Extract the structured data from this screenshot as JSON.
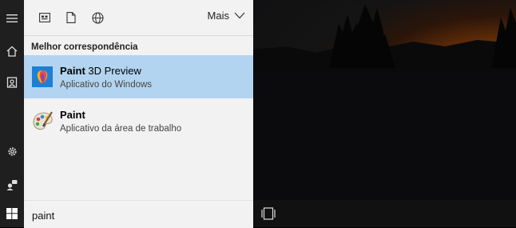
{
  "panel": {
    "more_label": "Mais",
    "section_title": "Melhor correspondência",
    "results": [
      {
        "name_bold": "Paint",
        "name_rest": " 3D Preview",
        "subtitle": "Aplicativo do Windows",
        "icon": "paint-3d-icon",
        "selected": true
      },
      {
        "name_bold": "Paint",
        "name_rest": "",
        "subtitle": "Aplicativo da área de trabalho",
        "icon": "paint-palette-icon",
        "selected": false
      }
    ]
  },
  "search": {
    "value": "paint"
  },
  "rail_icons": [
    "hamburger-menu-icon",
    "home-icon",
    "notebook-icon",
    "settings-icon",
    "feedback-icon",
    "windows-start-icon"
  ],
  "toolbar_icons": [
    "apps-filter-icon",
    "documents-filter-icon",
    "web-filter-icon",
    "chevron-down-icon"
  ],
  "taskbar_icons": [
    "task-view-icon"
  ],
  "colors": {
    "selection": "#b3d4f0",
    "panel_bg": "#f2f2f2",
    "rail_bg": "#1f1f1f"
  }
}
